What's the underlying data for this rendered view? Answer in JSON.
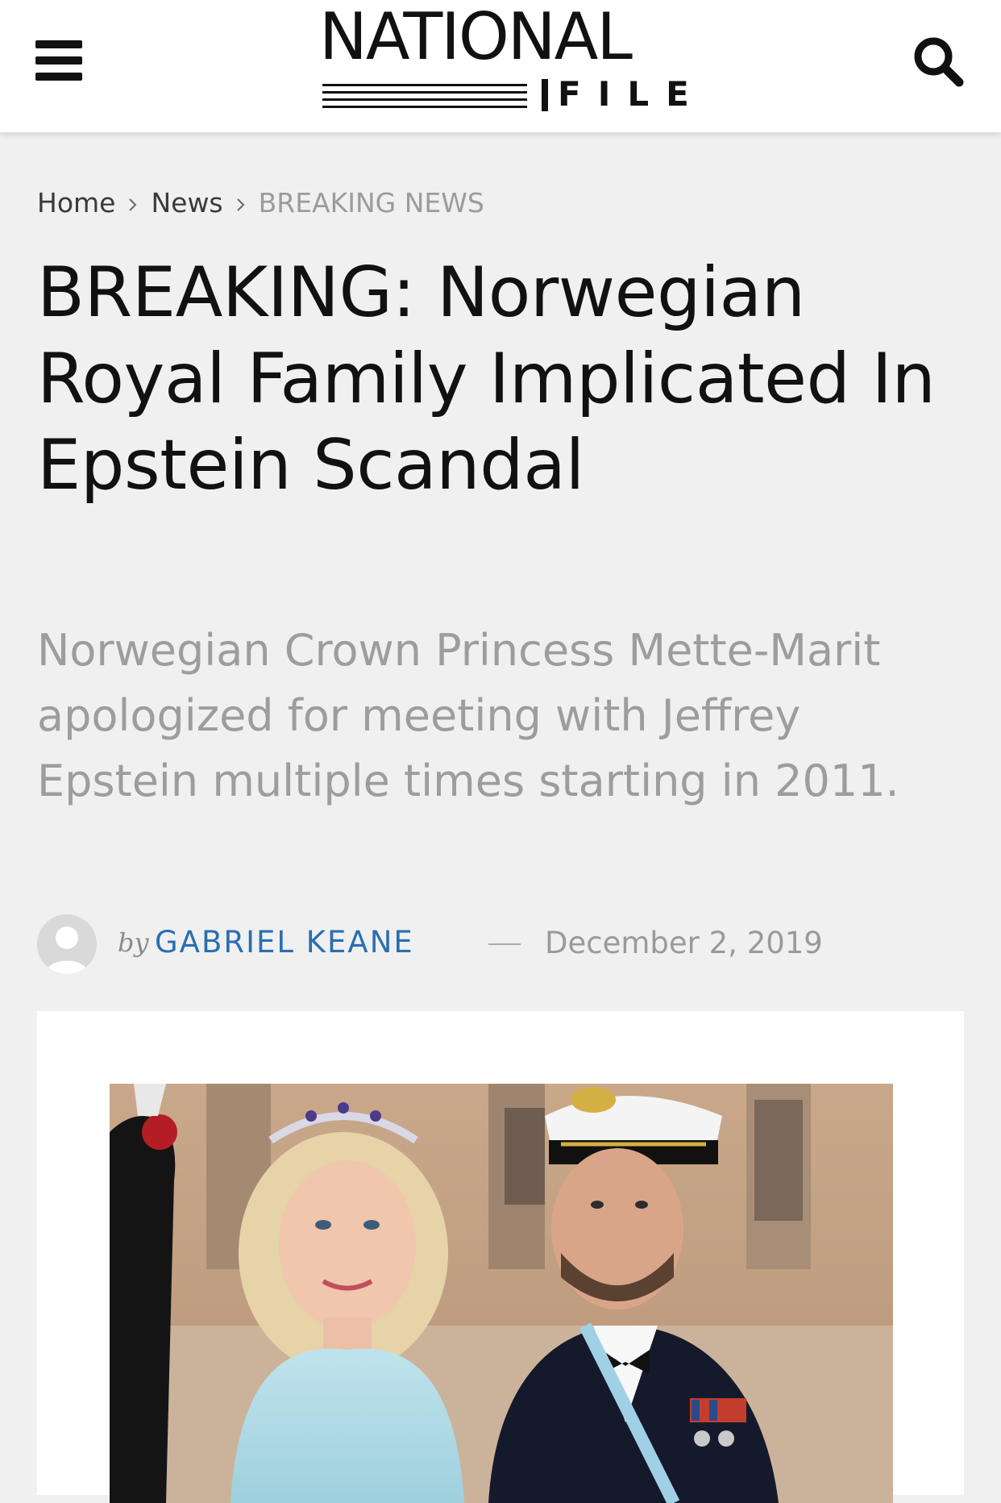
{
  "header": {
    "logo_top": "NATIONAL",
    "logo_bottom": "FILE",
    "menu_icon": "hamburger-menu-icon",
    "search_icon": "search-icon"
  },
  "breadcrumb": {
    "items": [
      "Home",
      "News",
      "BREAKING NEWS"
    ]
  },
  "article": {
    "title": "BREAKING: Norwegian Royal Family Implicated In Epstein Scandal",
    "subtitle": "Norwegian Crown Princess Mette-Marit apologized for meeting with Jeffrey Epstein multiple times starting in 2011.",
    "by_label": "by",
    "author": "GABRIEL KEANE",
    "date": "December 2, 2019"
  },
  "colors": {
    "accent_author": "#2a6fb0",
    "page_bg": "#f0f0f0",
    "subtitle": "#9d9d9d"
  }
}
